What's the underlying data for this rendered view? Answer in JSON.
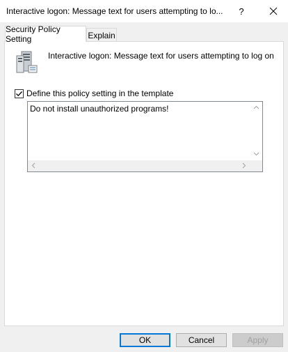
{
  "window": {
    "title": "Interactive logon: Message text for users attempting to lo...",
    "help_label": "?",
    "close_icon": "close-icon"
  },
  "tabs": [
    {
      "label": "Security Policy Setting",
      "active": true
    },
    {
      "label": "Explain",
      "active": false
    }
  ],
  "policy": {
    "icon": "server-policy-icon",
    "name": "Interactive logon: Message text for users attempting to log on"
  },
  "define_setting": {
    "label": "Define this policy setting in the template",
    "checked": true
  },
  "message_text": {
    "value": "Do not install unauthorized programs!"
  },
  "buttons": {
    "ok": "OK",
    "cancel": "Cancel",
    "apply": "Apply",
    "apply_disabled": true
  },
  "colors": {
    "accent": "#0078d7",
    "window_bg": "#f0f0f0",
    "panel_bg": "#ffffff"
  }
}
